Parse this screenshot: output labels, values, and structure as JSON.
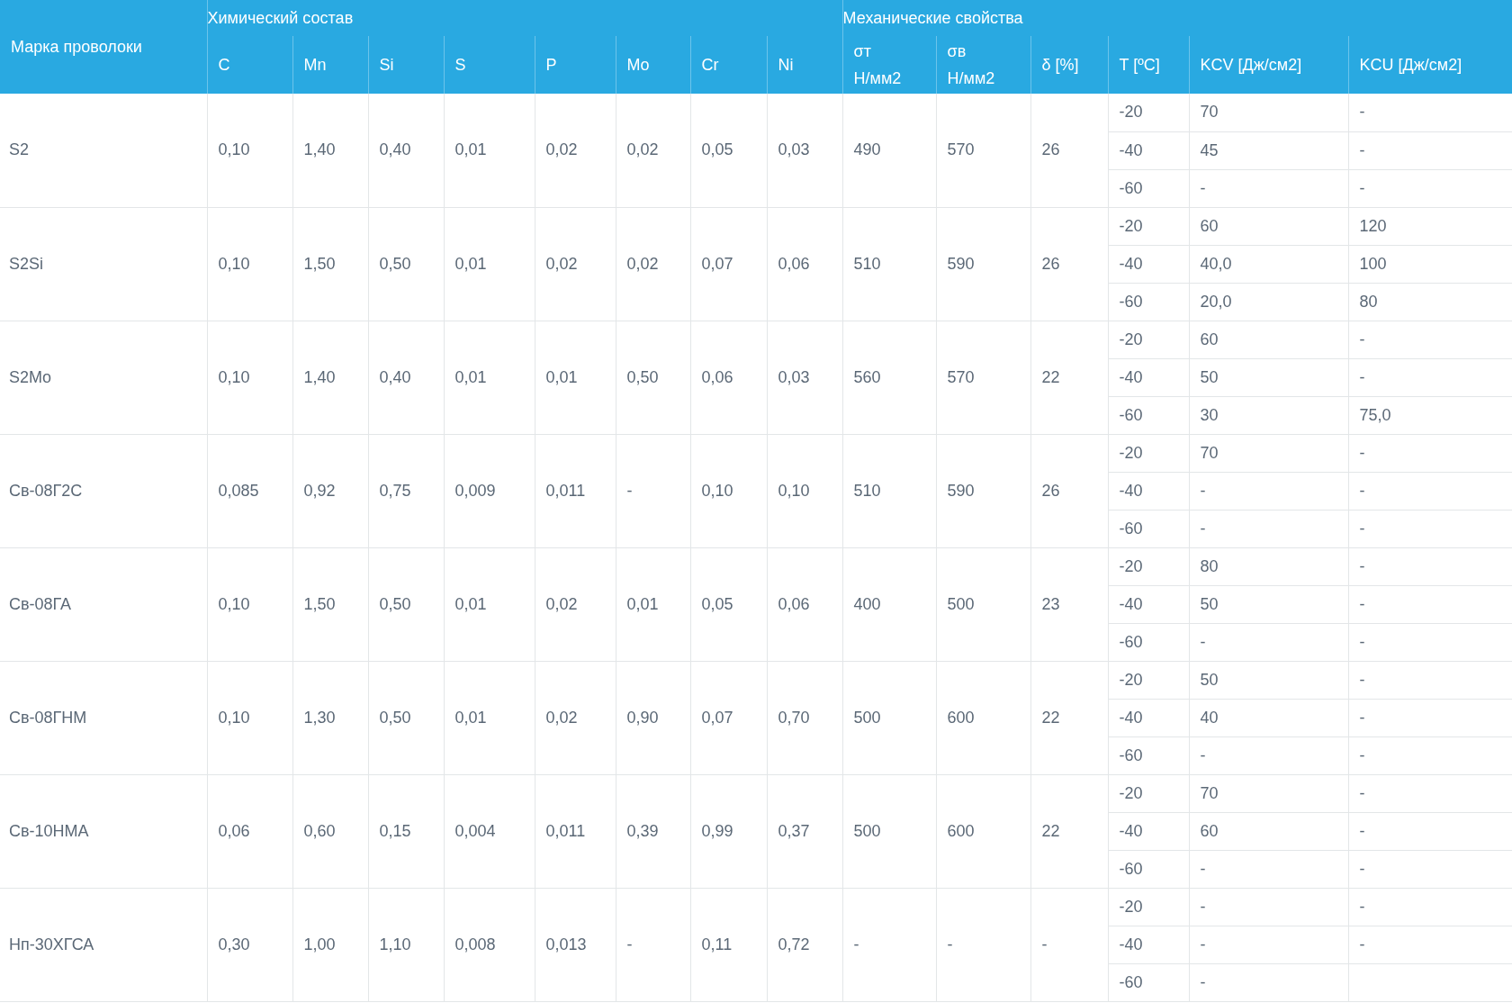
{
  "table": {
    "grade_header": "Марка проволоки",
    "chem_header": "Химический состав",
    "mech_header": "Механические свойства",
    "chem_columns": [
      "C",
      "Mn",
      "Si",
      "S",
      "P",
      "Mo",
      "Cr",
      "Ni"
    ],
    "mech_columns": [
      "σт\nН/мм2",
      "σв\nН/мм2",
      "δ [%]",
      "T [ºC]",
      "KCV [Дж/см2]",
      "KCU [Дж/см2]"
    ],
    "rows": [
      {
        "grade": "S2",
        "chem": [
          "0,10",
          "1,40",
          "0,40",
          "0,01",
          "0,02",
          "0,02",
          "0,05",
          "0,03"
        ],
        "yield": "490",
        "tensile": "570",
        "elongation": "26",
        "impact": [
          {
            "t": "-20",
            "kcv": "70",
            "kcu": "-"
          },
          {
            "t": "-40",
            "kcv": "45",
            "kcu": "-"
          },
          {
            "t": "-60",
            "kcv": "-",
            "kcu": "-"
          }
        ]
      },
      {
        "grade": "S2Si",
        "chem": [
          "0,10",
          "1,50",
          "0,50",
          "0,01",
          "0,02",
          "0,02",
          "0,07",
          "0,06"
        ],
        "yield": "510",
        "tensile": "590",
        "elongation": "26",
        "impact": [
          {
            "t": "-20",
            "kcv": "60",
            "kcu": "120"
          },
          {
            "t": "-40",
            "kcv": "40,0",
            "kcu": "100"
          },
          {
            "t": "-60",
            "kcv": "20,0",
            "kcu": "80"
          }
        ]
      },
      {
        "grade": "S2Mo",
        "chem": [
          "0,10",
          "1,40",
          "0,40",
          "0,01",
          "0,01",
          "0,50",
          "0,06",
          "0,03"
        ],
        "yield": "560",
        "tensile": "570",
        "elongation": "22",
        "impact": [
          {
            "t": "-20",
            "kcv": "60",
            "kcu": "-"
          },
          {
            "t": "-40",
            "kcv": "50",
            "kcu": "-"
          },
          {
            "t": "-60",
            "kcv": "30",
            "kcu": "75,0"
          }
        ]
      },
      {
        "grade": "Св-08Г2С",
        "chem": [
          "0,085",
          "0,92",
          "0,75",
          "0,009",
          "0,011",
          "-",
          "0,10",
          "0,10"
        ],
        "yield": "510",
        "tensile": "590",
        "elongation": "26",
        "impact": [
          {
            "t": "-20",
            "kcv": "70",
            "kcu": "-"
          },
          {
            "t": "-40",
            "kcv": "-",
            "kcu": "-"
          },
          {
            "t": "-60",
            "kcv": "-",
            "kcu": "-"
          }
        ]
      },
      {
        "grade": "Св-08ГА",
        "chem": [
          "0,10",
          "1,50",
          "0,50",
          "0,01",
          "0,02",
          "0,01",
          "0,05",
          "0,06"
        ],
        "yield": "400",
        "tensile": "500",
        "elongation": "23",
        "impact": [
          {
            "t": "-20",
            "kcv": "80",
            "kcu": "-"
          },
          {
            "t": "-40",
            "kcv": "50",
            "kcu": "-"
          },
          {
            "t": "-60",
            "kcv": "-",
            "kcu": "-"
          }
        ]
      },
      {
        "grade": "Св-08ГНМ",
        "chem": [
          "0,10",
          "1,30",
          "0,50",
          "0,01",
          "0,02",
          "0,90",
          "0,07",
          "0,70"
        ],
        "yield": "500",
        "tensile": "600",
        "elongation": "22",
        "impact": [
          {
            "t": "-20",
            "kcv": "50",
            "kcu": "-"
          },
          {
            "t": "-40",
            "kcv": "40",
            "kcu": "-"
          },
          {
            "t": "-60",
            "kcv": "-",
            "kcu": "-"
          }
        ]
      },
      {
        "grade": "Св-10НМА",
        "chem": [
          "0,06",
          "0,60",
          "0,15",
          "0,004",
          "0,011",
          "0,39",
          "0,99",
          "0,37"
        ],
        "yield": "500",
        "tensile": "600",
        "elongation": "22",
        "impact": [
          {
            "t": "-20",
            "kcv": "70",
            "kcu": "-"
          },
          {
            "t": "-40",
            "kcv": "60",
            "kcu": "-"
          },
          {
            "t": "-60",
            "kcv": "-",
            "kcu": "-"
          }
        ]
      },
      {
        "grade": "Нп-30ХГСА",
        "chem": [
          "0,30",
          "1,00",
          "1,10",
          "0,008",
          "0,013",
          "-",
          "0,11",
          "0,72"
        ],
        "yield": "-",
        "tensile": "-",
        "elongation": "-",
        "impact": [
          {
            "t": "-20",
            "kcv": "-",
            "kcu": "-"
          },
          {
            "t": "-40",
            "kcv": "-",
            "kcu": "-"
          },
          {
            "t": "-60",
            "kcv": "-"
          }
        ]
      }
    ]
  }
}
